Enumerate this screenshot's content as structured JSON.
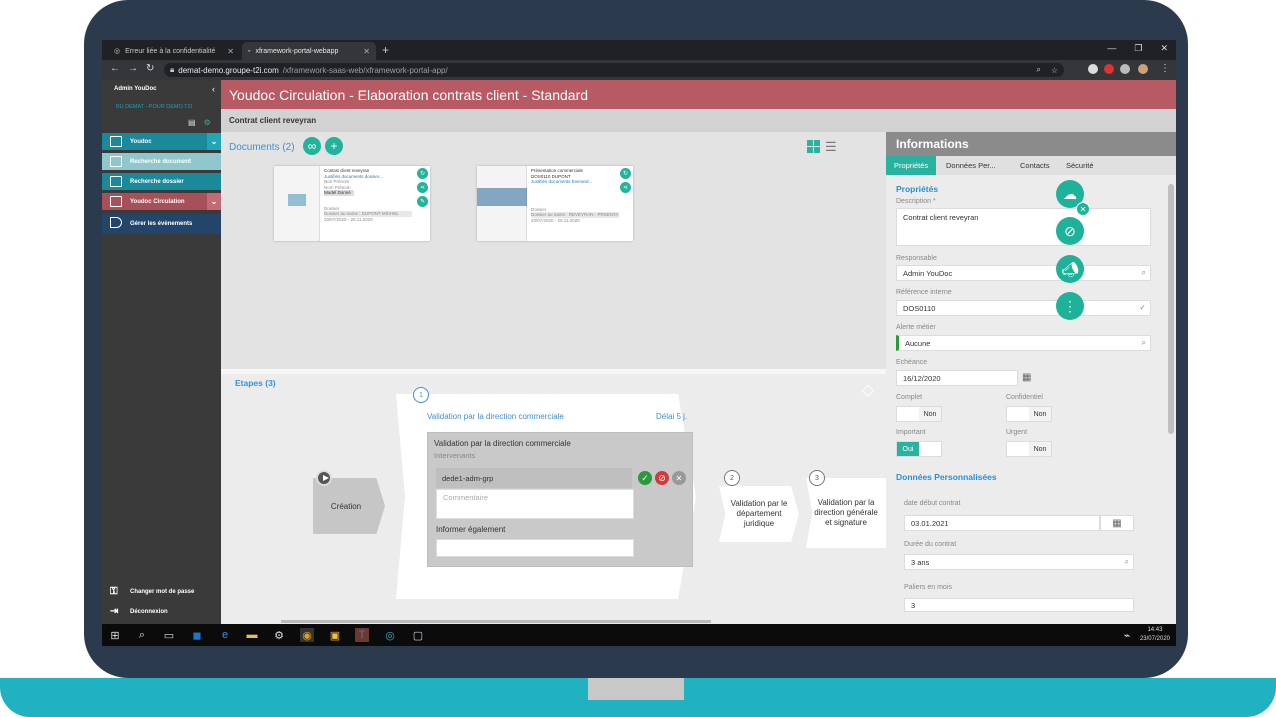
{
  "browser": {
    "tabs": [
      {
        "label": "Erreur liée à la confidentialité"
      },
      {
        "label": "xframework-portal-webapp"
      }
    ],
    "url_host": "demat-demo.groupe-t2i.com",
    "url_path": "/xframework-saas-web/xframework-portal-app/"
  },
  "sidebar": {
    "user": "Admin YouDoc",
    "org": "BU DEMAT - POUR DEMO T2I",
    "items": [
      {
        "label": "Youdoc"
      },
      {
        "label": "Recherche document"
      },
      {
        "label": "Recherche dossier"
      },
      {
        "label": "Youdoc Circulation"
      },
      {
        "label": "Gérer les évènements"
      }
    ],
    "bottom": [
      {
        "label": "Changer mot de passe"
      },
      {
        "label": "Déconnexion"
      }
    ]
  },
  "header": {
    "title": "Youdoc Circulation - Elaboration contrats client - Standard",
    "subtitle": "Contrat client reveyran"
  },
  "documents": {
    "title": "Documents (2)",
    "cards": [
      {
        "title": "Contrat client reveyran",
        "link": "Justifiés documents dossier...",
        "line1": "Non Prénom",
        "line2": "Nom Prénom",
        "chip": "Model Donné",
        "line3": "Dossier",
        "line4": "Dossier: au ...",
        "line5": "Dossier au name : DUPONT MICHEL",
        "date": "20/07/2020 - 20.11.2020"
      },
      {
        "title": "Présentation commerciale",
        "link": "Justifiés documents Everand...",
        "line1": "DOS0110 DUPONT",
        "line2": "",
        "chip": "",
        "line3": "Dossier",
        "line4": "Dossier: au ...",
        "line5": "Dossier au name : REVEYRAN - PRSENTA",
        "date": "20/07/2020 - 20.11.2020"
      }
    ]
  },
  "etapes": {
    "title": "Etapes (3)",
    "creation": "Création",
    "steps": [
      {
        "num": "1",
        "title": "Validation par la direction commerciale",
        "delay": "Délai 5 j."
      },
      {
        "num": "2",
        "title": "Validation par le département juridique"
      },
      {
        "num": "3",
        "title": "Validation par la direction générale et signature"
      }
    ],
    "validation": {
      "title": "Validation par la direction commerciale",
      "intervenants": "Intervenants",
      "who": "dede1-adm-grp",
      "comment_placeholder": "Commentaire",
      "inform_label": "Informer également"
    }
  },
  "info": {
    "title": "Informations",
    "tabs": [
      {
        "label": "Propriétés"
      },
      {
        "label": "Données Per..."
      },
      {
        "label": "Contacts"
      },
      {
        "label": "Sécurité"
      }
    ],
    "props_title": "Propriétés",
    "description_label": "Description *",
    "description_value": "Contrat client reveyran",
    "responsable_label": "Responsable",
    "responsable_value": "Admin YouDoc",
    "reference_label": "Référence interne",
    "reference_value": "DOS0110",
    "alerte_label": "Alerte métier",
    "alerte_value": "Aucune",
    "echeance_label": "Echéance",
    "echeance_value": "16/12/2020",
    "complet_label": "Complet",
    "complet_value": "Non",
    "confidentiel_label": "Confidentiel",
    "confidentiel_value": "Non",
    "important_label": "Important",
    "important_value": "Oui",
    "urgent_label": "Urgent",
    "urgent_value": "Non",
    "perso_title": "Données Personnalisées",
    "date_debut_label": "date début contrat",
    "date_debut_value": "03.01.2021",
    "duree_label": "Durée du contrat",
    "duree_value": "3 ans",
    "paliers_label": "Paliers en mois",
    "paliers_value": "3"
  },
  "taskbar": {
    "time": "14:43",
    "date": "23/07/2020"
  },
  "colors": {
    "title_red": "#b85a63",
    "teal": "#22b39c",
    "frame": "#2c3a4d",
    "base": "#20b2c1"
  }
}
